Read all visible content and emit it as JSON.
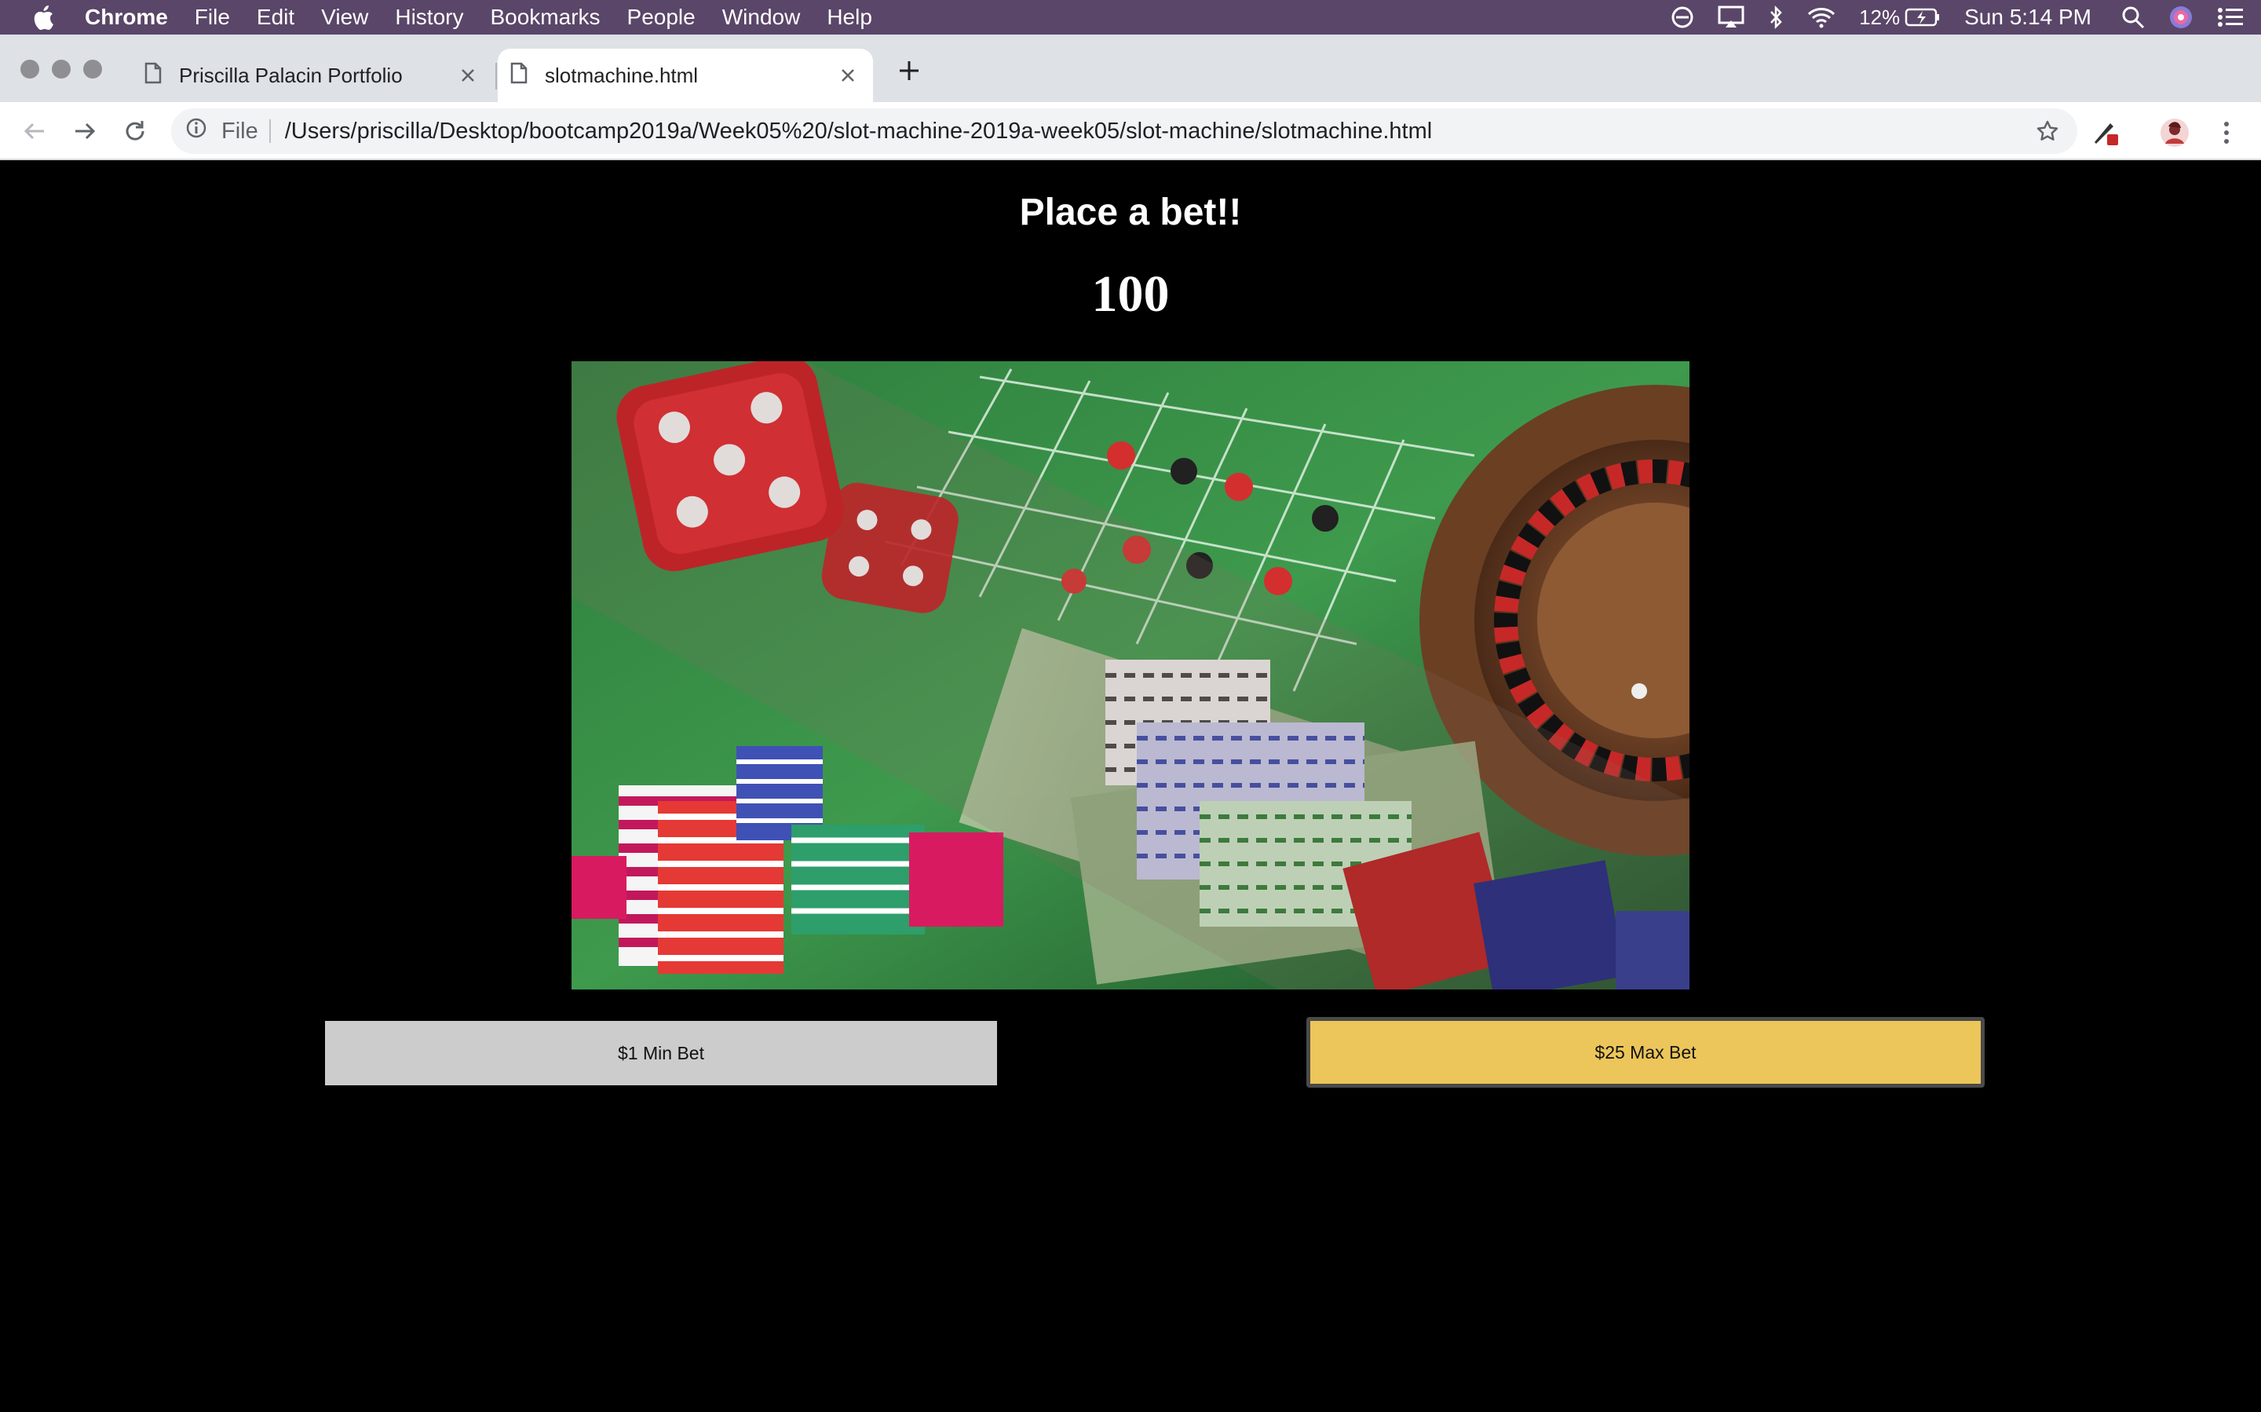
{
  "menubar": {
    "app_name": "Chrome",
    "items": [
      "File",
      "Edit",
      "View",
      "History",
      "Bookmarks",
      "People",
      "Window",
      "Help"
    ],
    "battery_percent": "12%",
    "clock": "Sun 5:14 PM"
  },
  "tabs": [
    {
      "title": "Priscilla Palacin Portfolio",
      "active": false
    },
    {
      "title": "slotmachine.html",
      "active": true
    }
  ],
  "toolbar": {
    "scheme_label": "File",
    "url": "/Users/priscilla/Desktop/bootcamp2019a/Week05%20/slot-machine-2019a-week05/slot-machine/slotmachine.html"
  },
  "page": {
    "heading": "Place a bet!!",
    "balance": "100",
    "image_description_icon": "casino-dice-chips-roulette-image",
    "min_bet_label": "$1 Min Bet",
    "max_bet_label": "$25 Max Bet"
  },
  "colors": {
    "menubar_bg": "#5a4668",
    "page_bg": "#000000",
    "min_button_bg": "#cccccc",
    "max_button_bg": "#ecc65a"
  }
}
